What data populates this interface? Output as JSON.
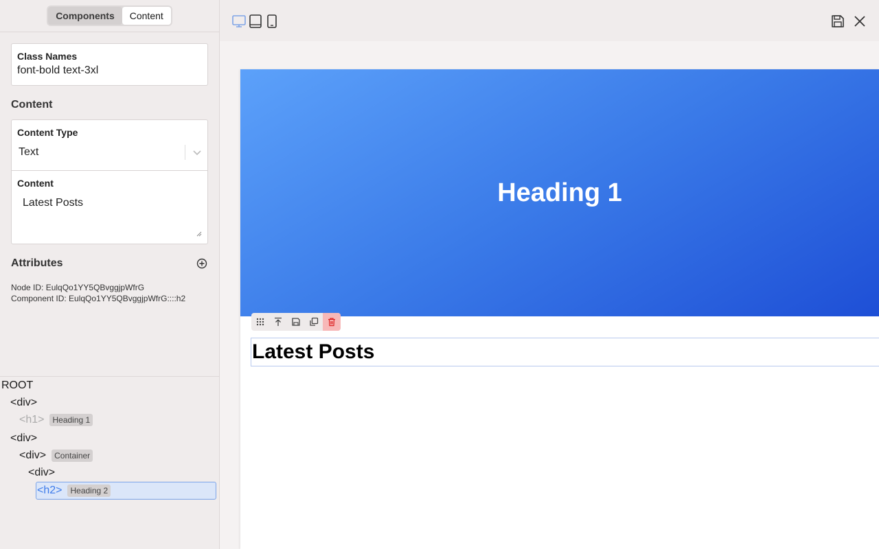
{
  "sidebar": {
    "tabs": [
      {
        "label": "Components"
      },
      {
        "label": "Content"
      }
    ],
    "class_names": {
      "label": "Class Names",
      "value": "font-bold text-3xl"
    },
    "content_section_title": "Content",
    "content_type": {
      "label": "Content Type",
      "value": "Text"
    },
    "content": {
      "label": "Content",
      "value": "Latest Posts"
    },
    "attributes_title": "Attributes",
    "node_id": "Node ID: EulqQo1YY5QBvggjpWfrG",
    "component_id": "Component ID: EulqQo1YY5QBvggjpWfrG::::h2"
  },
  "tree": {
    "root": "ROOT",
    "nodes": [
      {
        "tag": "<div>",
        "badge": ""
      },
      {
        "tag": "<h1>",
        "badge": "Heading 1"
      },
      {
        "tag": "<div>",
        "badge": ""
      },
      {
        "tag": "<div>",
        "badge": "Container"
      },
      {
        "tag": "<div>",
        "badge": ""
      },
      {
        "tag": "<h2>",
        "badge": "Heading 2"
      }
    ]
  },
  "canvas": {
    "hero_heading": "Heading 1",
    "section_heading": "Latest Posts"
  },
  "colors": {
    "hero_start": "#5ca1fa",
    "hero_end": "#1e4fd6",
    "selected": "#3d7bea"
  }
}
